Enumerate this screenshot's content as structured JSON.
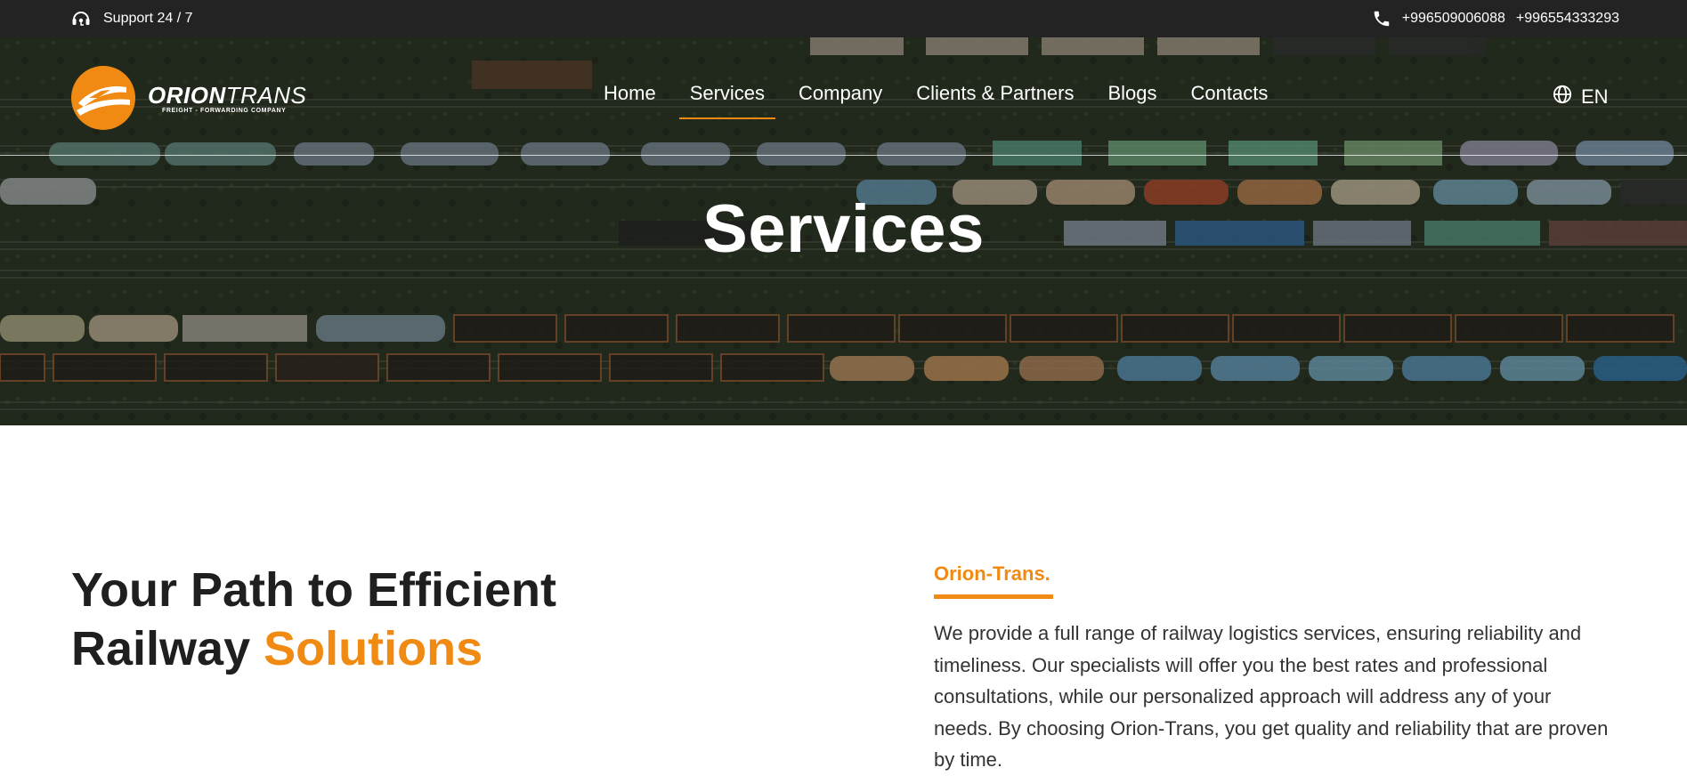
{
  "topbar": {
    "support_icon": "headset-icon",
    "support_label": "Support 24 / 7",
    "phone_icon": "phone-icon",
    "phone_1": "+996509006088",
    "phone_2": "+996554333293"
  },
  "logo": {
    "name_bold": "ORION",
    "name_light": "TRANS",
    "tagline": "FREIGHT - FORWARDING COMPANY"
  },
  "nav": {
    "items": [
      {
        "label": "Home"
      },
      {
        "label": "Services",
        "active": true
      },
      {
        "label": "Company"
      },
      {
        "label": "Clients & Partners"
      },
      {
        "label": "Blogs"
      },
      {
        "label": "Contacts"
      }
    ]
  },
  "language": {
    "icon": "globe-icon",
    "label": "EN"
  },
  "hero": {
    "title": "Services",
    "background": "aerial photo of railway freight yard with rows of wagons"
  },
  "content": {
    "heading_part1": "Your Path to Efficient",
    "heading_part2": "Railway",
    "heading_accent": "Solutions",
    "brand_label": "Orion-Trans.",
    "description": "We provide a full range of railway logistics services, ensuring reliability and timeliness. Our specialists will offer you the best rates and professional consultations, while our personalized approach will address any of your needs. By choosing Orion-Trans, you get quality and reliability that are proven by time."
  },
  "colors": {
    "accent": "#f08a12",
    "topbar": "#232323",
    "heading_text": "#1f1f1f",
    "body_text": "#333333"
  }
}
